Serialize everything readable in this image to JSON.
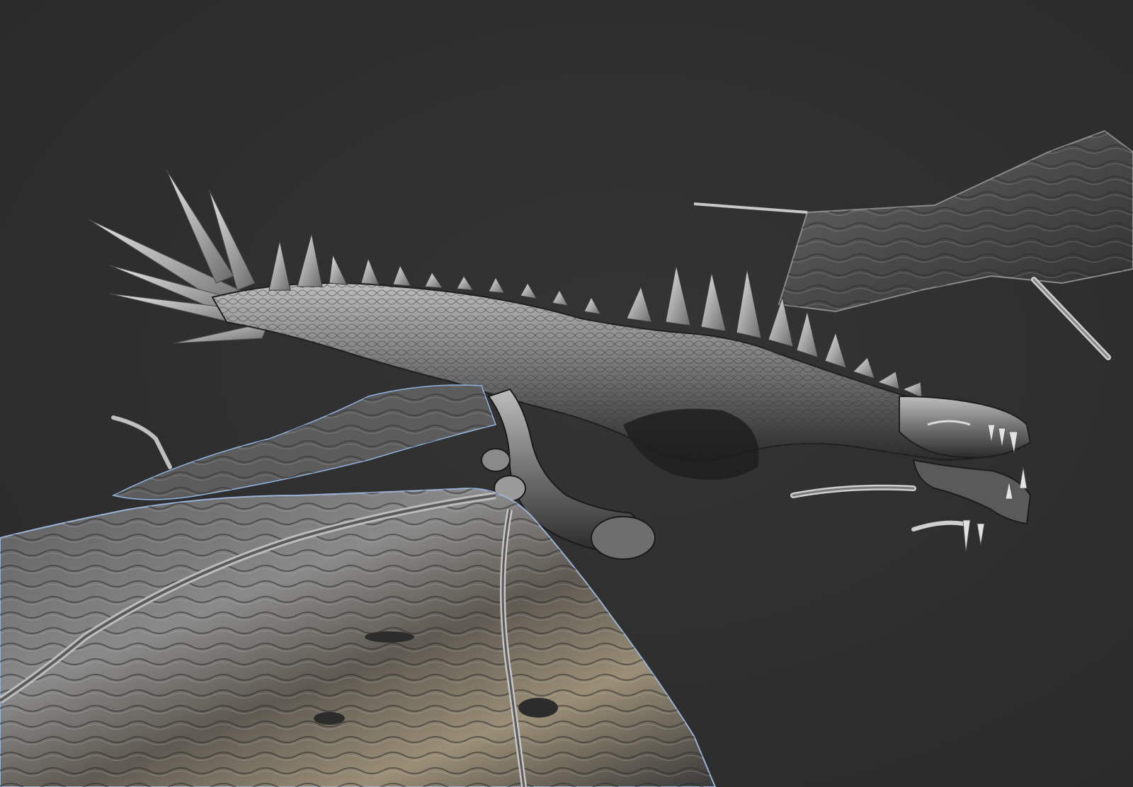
{
  "scene": {
    "background_color": "#2f2f2f",
    "subject": "dragon-sculpt",
    "material_colors": {
      "base": "#6e6e6e",
      "highlight": "#d8d8d8",
      "shadow": "#1c1c1c",
      "rim_blue": "#8fb4e0",
      "rim_gold": "#c8a76a"
    }
  }
}
